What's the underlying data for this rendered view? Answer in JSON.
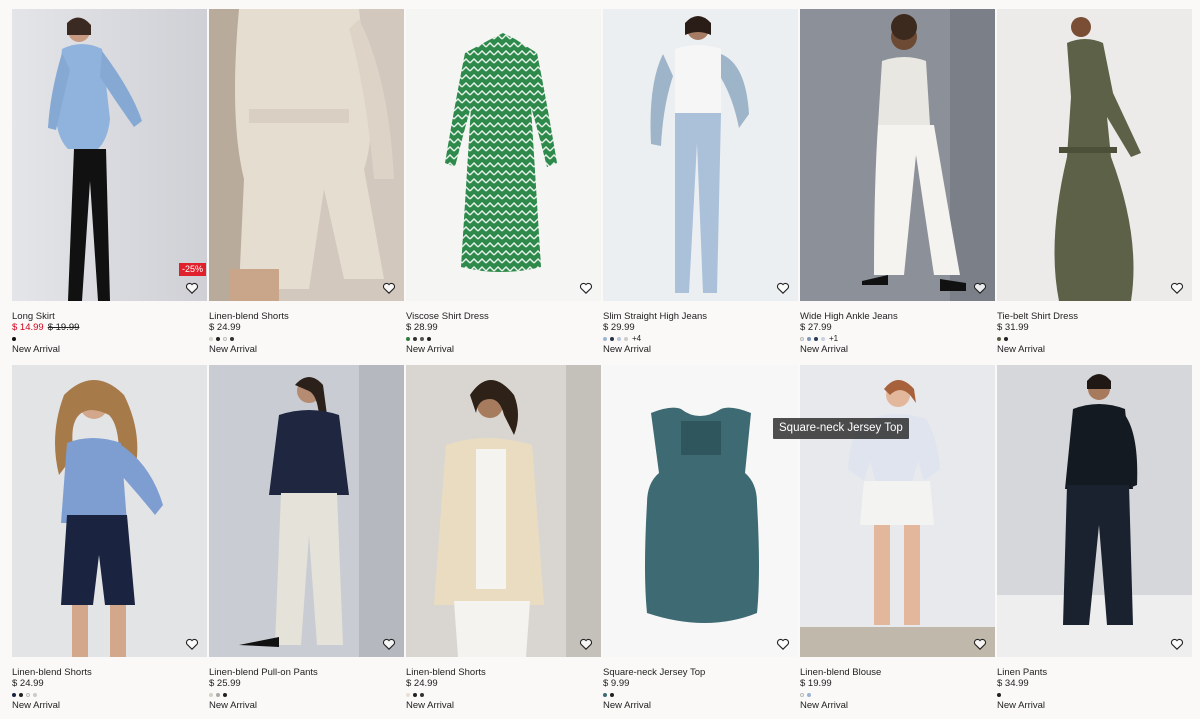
{
  "products": [
    {
      "name": "Long Skirt",
      "price": "$ 14.99",
      "old_price": "$ 19.99",
      "sale": true,
      "discount": "-25%",
      "swatches": [
        "#111"
      ],
      "more": "",
      "tag": "New Arrival",
      "icon": "heart-icon"
    },
    {
      "name": "Linen-blend Shorts",
      "price": "$ 24.99",
      "old_price": "",
      "sale": false,
      "discount": "",
      "swatches": [
        "#d8d4cc",
        "#222",
        "#faf9f8",
        "#333"
      ],
      "more": "",
      "tag": "New Arrival",
      "icon": "heart-icon"
    },
    {
      "name": "Viscose Shirt Dress",
      "price": "$ 28.99",
      "old_price": "",
      "sale": false,
      "discount": "",
      "swatches": [
        "#2e7d3e",
        "#333",
        "#555",
        "#222"
      ],
      "more": "",
      "tag": "New Arrival",
      "icon": "heart-icon"
    },
    {
      "name": "Slim Straight High Jeans",
      "price": "$ 29.99",
      "old_price": "",
      "sale": false,
      "discount": "",
      "swatches": [
        "#9fb6cf",
        "#2a3344",
        "#b9c7d6",
        "#ccc"
      ],
      "more": "+4",
      "tag": "New Arrival",
      "icon": "heart-icon"
    },
    {
      "name": "Wide High Ankle Jeans",
      "price": "$ 27.99",
      "old_price": "",
      "sale": false,
      "discount": "",
      "swatches": [
        "#eee",
        "#7c95b8",
        "#2c3a55",
        "#c9d3e0"
      ],
      "more": "+1",
      "tag": "New Arrival",
      "icon": "heart-icon"
    },
    {
      "name": "Tie-belt Shirt Dress",
      "price": "$ 31.99",
      "old_price": "",
      "sale": false,
      "discount": "",
      "swatches": [
        "#5a5d46",
        "#222"
      ],
      "more": "",
      "tag": "New Arrival",
      "icon": "heart-icon"
    },
    {
      "name": "Linen-blend Shorts",
      "price": "$ 24.99",
      "old_price": "",
      "sale": false,
      "discount": "",
      "swatches": [
        "#1a2340",
        "#222",
        "#faf9f8",
        "#ccc"
      ],
      "more": "",
      "tag": "New Arrival",
      "icon": "heart-icon"
    },
    {
      "name": "Linen-blend Pull-on Pants",
      "price": "$ 25.99",
      "old_price": "",
      "sale": false,
      "discount": "",
      "swatches": [
        "#d6d1c6",
        "#aaa",
        "#222"
      ],
      "more": "",
      "tag": "New Arrival",
      "icon": "heart-icon"
    },
    {
      "name": "Linen-blend Shorts",
      "price": "$ 24.99",
      "old_price": "",
      "sale": false,
      "discount": "",
      "swatches": [
        "#e7e0d0",
        "#222",
        "#333"
      ],
      "more": "",
      "tag": "New Arrival",
      "icon": "heart-icon"
    },
    {
      "name": "Square-neck Jersey Top",
      "price": "$ 9.99",
      "old_price": "",
      "sale": false,
      "discount": "",
      "swatches": [
        "#3e6b73",
        "#222"
      ],
      "more": "",
      "tag": "New Arrival",
      "icon": "heart-icon"
    },
    {
      "name": "Linen-blend Blouse",
      "price": "$ 19.99",
      "old_price": "",
      "sale": false,
      "discount": "",
      "swatches": [
        "#faf9f8",
        "#9bb3d6"
      ],
      "more": "",
      "tag": "New Arrival",
      "icon": "heart-icon"
    },
    {
      "name": "Linen Pants",
      "price": "$ 34.99",
      "old_price": "",
      "sale": false,
      "discount": "",
      "swatches": [
        "#222"
      ],
      "more": "",
      "tag": "New Arrival",
      "icon": "heart-icon"
    }
  ],
  "tooltip": "Square-neck Jersey Top",
  "colors": {
    "sale": "#d0021b",
    "badge": "#e0202c"
  }
}
